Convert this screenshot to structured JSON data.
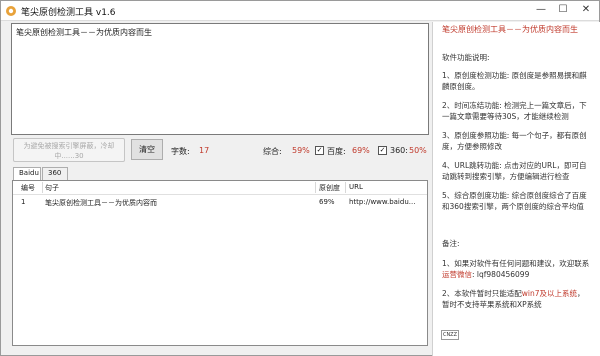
{
  "window": {
    "title": "笔尖原创检测工具 v1.6"
  },
  "input": {
    "text": "笔尖原创检测工具－－为优质内容而生"
  },
  "toolbar": {
    "disabled_btn_line1": "为避免被搜索引擎屏蔽，冷却",
    "disabled_btn_line2": "中......30",
    "clear_label": "清空",
    "word_count_label": "字数:",
    "word_count_value": "17",
    "overall_label": "综合:",
    "overall_value": "59%",
    "baidu_check": "✓",
    "baidu_label": "百度:",
    "baidu_value": "69%",
    "s360_check": "✓",
    "s360_label": "360:",
    "s360_value": "50%"
  },
  "tabs": [
    {
      "label": "Baidu"
    },
    {
      "label": "360"
    }
  ],
  "table": {
    "headers": [
      "编号",
      "句子",
      "原创度",
      "URL"
    ],
    "rows": [
      {
        "num": "1",
        "sentence": "笔尖原创检测工具－－为优质内容而",
        "originality": "69%",
        "url": "http://www.baidu..."
      }
    ]
  },
  "sidebar": {
    "heading": "笔尖原创检测工具－－为优质内容而生",
    "features_title": "软件功能说明:",
    "f1": "1、原创度检测功能: 原创度是参照易撰和麒麟原创度。",
    "f2": "2、时间冻结功能: 检测完上一篇文章后，下一篇文章需要等待30S，才能继续检测",
    "f3": "3、原创度参照功能: 每一个句子，都有原创度，方便参照修改",
    "f4": "4、URL跳转功能: 点击对应的URL，即可自动跳转到搜索引擎，方便编辑进行检查",
    "f5": "5、综合原创度功能: 综合原创度综合了百度和360搜索引擎，两个原创度的综合平均值",
    "notes_title": "备注:",
    "n1_a": "1、如果对软件有任何问题和建议，欢迎联系",
    "n1_link": "运营微信",
    "n1_b": ": lqf980456099",
    "n2_a": "2、本软件暂时只能适配",
    "n2_red": "win7及以上系统",
    "n2_b": "，暂时不支持苹果系统和XP系统",
    "logo_text": "CNZZ"
  }
}
